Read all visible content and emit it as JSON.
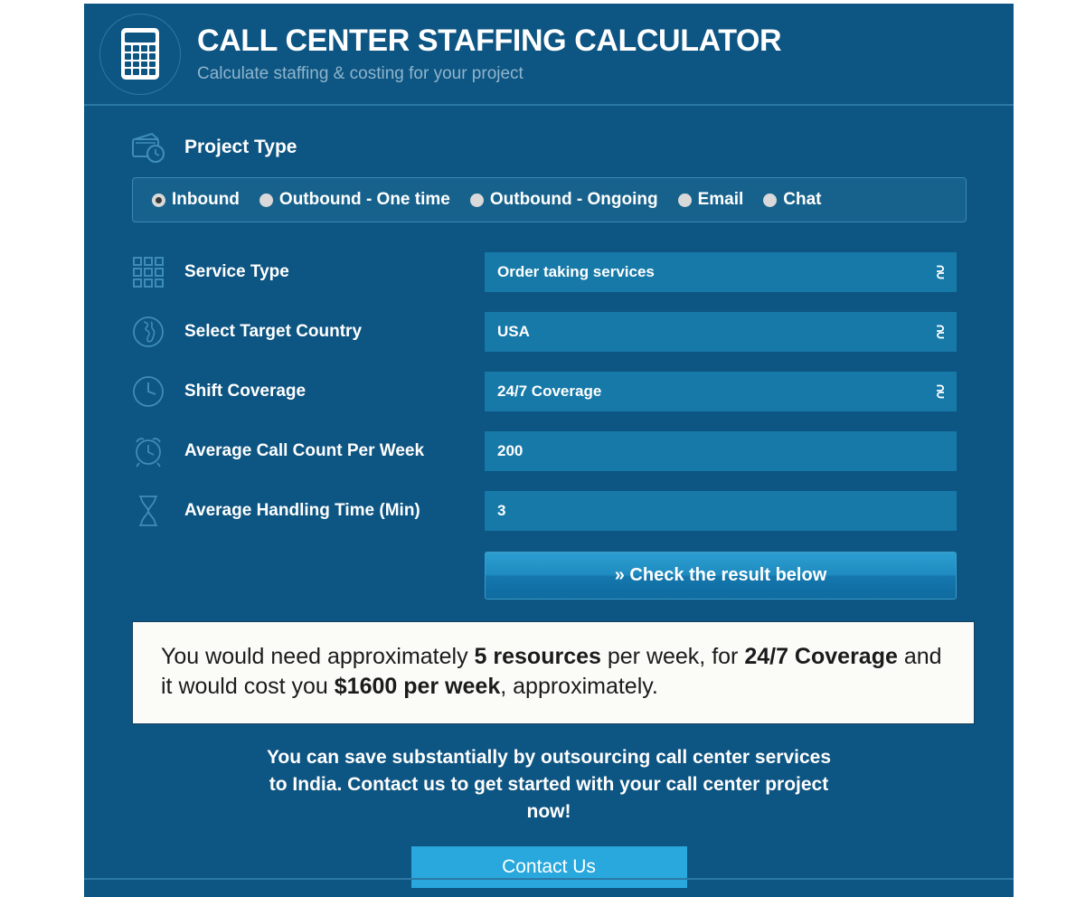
{
  "header": {
    "title": "CALL CENTER STAFFING CALCULATOR",
    "subtitle": "Calculate staffing & costing for your project",
    "logo_icon": "calculator-icon"
  },
  "project_type": {
    "label": "Project Type",
    "icon": "wallet-clock-icon",
    "options": [
      {
        "label": "Inbound",
        "selected": true
      },
      {
        "label": "Outbound - One time",
        "selected": false
      },
      {
        "label": "Outbound - Ongoing",
        "selected": false
      },
      {
        "label": "Email",
        "selected": false
      },
      {
        "label": "Chat",
        "selected": false
      }
    ]
  },
  "fields": [
    {
      "label": "Service Type",
      "icon": "grid-icon",
      "type": "select",
      "value": "Order taking services"
    },
    {
      "label": "Select Target Country",
      "icon": "globe-icon",
      "type": "select",
      "value": "USA"
    },
    {
      "label": "Shift Coverage",
      "icon": "clock-icon",
      "type": "select",
      "value": "24/7 Coverage"
    },
    {
      "label": "Average Call Count Per Week",
      "icon": "alarm-clock-icon",
      "type": "input",
      "value": "200"
    },
    {
      "label": "Average Handling Time (Min)",
      "icon": "hourglass-icon",
      "type": "input",
      "value": "3"
    }
  ],
  "check_button": {
    "label": "» Check the result below"
  },
  "result": {
    "line1_pre": "You would need approximately ",
    "resources": "5 resources",
    "line1_mid": " per week, for ",
    "coverage": "24/7 Coverage",
    "line2_pre": "and it would cost you ",
    "cost": "$1600 per week",
    "line2_post": ", approximately."
  },
  "footer": {
    "text": "You can save substantially by outsourcing call center services to India. Contact us to get started with your call center project now!",
    "contact_label": "Contact Us"
  },
  "colors": {
    "panel_bg": "#0d5582",
    "field_bg": "#1679a8",
    "accent": "#29a8dd",
    "divider": "#2c79a6",
    "result_bg": "#fbfbf7"
  }
}
